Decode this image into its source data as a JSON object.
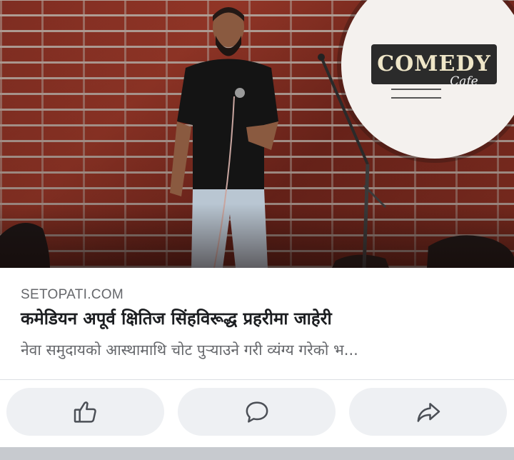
{
  "post": {
    "source": "SETOPATI.COM",
    "headline": "कमेडियन अपूर्व क्षितिज सिंहविरूद्ध प्रहरीमा जाहेरी",
    "description": "नेवा समुदायको आस्थामाथि चोट पुर्‍याउने गरी व्यंग्य गरेको भ..."
  },
  "image": {
    "logo_text": "COMEDY",
    "logo_sub": "Cafe"
  },
  "actions": [
    {
      "icon": "like-icon"
    },
    {
      "icon": "comment-icon"
    },
    {
      "icon": "share-icon"
    }
  ],
  "colors": {
    "action_bg": "#eef0f3",
    "headline": "#1c1e21",
    "secondary_text": "#65676b"
  }
}
